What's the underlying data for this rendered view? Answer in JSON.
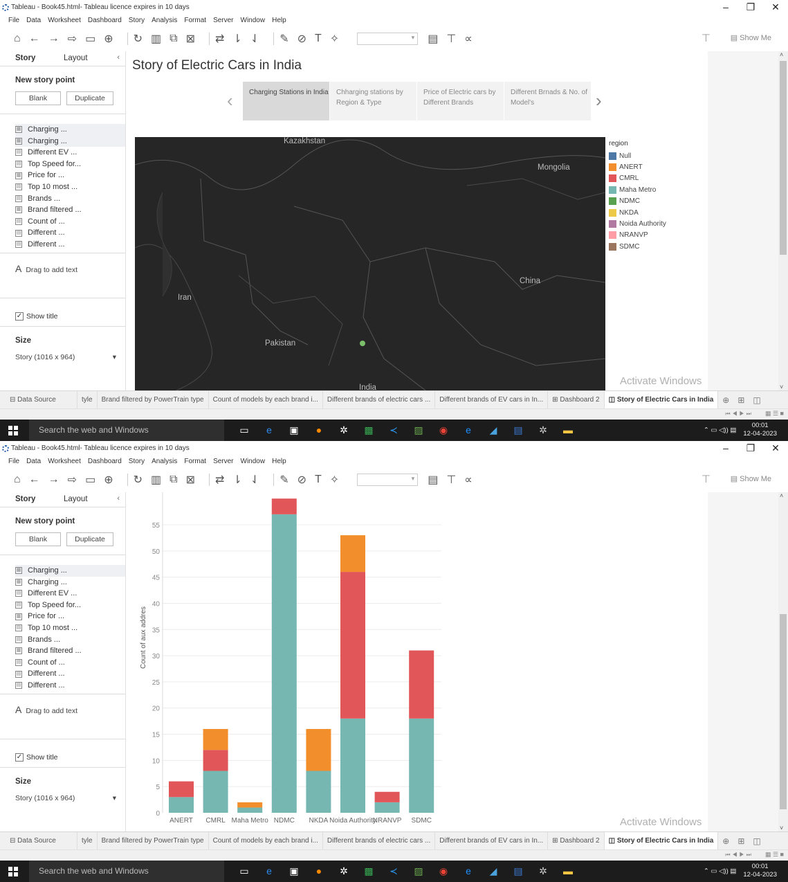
{
  "window": {
    "title": "Tableau - Book45.html- Tableau licence expires in 10 days",
    "min": "–",
    "restore": "❐",
    "close": "✕"
  },
  "menu": [
    "File",
    "Data",
    "Worksheet",
    "Dashboard",
    "Story",
    "Analysis",
    "Format",
    "Server",
    "Window",
    "Help"
  ],
  "toolbar": {
    "show_me": "Show Me"
  },
  "sidebar": {
    "tabs": [
      "Story",
      "Layout"
    ],
    "collapse": "‹",
    "new_story_point": "New story point",
    "blank": "Blank",
    "duplicate": "Duplicate",
    "sheets": [
      {
        "label": "Charging ...",
        "icon": "dashboard"
      },
      {
        "label": "Charging ...",
        "icon": "dashboard"
      },
      {
        "label": "Different EV ...",
        "icon": "worksheet"
      },
      {
        "label": "Top Speed for...",
        "icon": "worksheet"
      },
      {
        "label": "Price for ...",
        "icon": "dashboard"
      },
      {
        "label": "Top 10 most ...",
        "icon": "worksheet"
      },
      {
        "label": "Brands ...",
        "icon": "worksheet"
      },
      {
        "label": "Brand filtered ...",
        "icon": "dashboard"
      },
      {
        "label": "Count of ...",
        "icon": "worksheet"
      },
      {
        "label": "Different ...",
        "icon": "worksheet"
      },
      {
        "label": "Different ...",
        "icon": "worksheet"
      }
    ],
    "drag_text": "Drag to add text",
    "drag_icon": "A",
    "show_title": "Show title",
    "size_title": "Size",
    "size_value": "Story (1016 x 964)"
  },
  "story": {
    "title": "Story of Electric Cars in India",
    "points": [
      "Charging Stations in India",
      "Chharging stations by Region & Type",
      "Price of Electric cars by Different  Brands",
      "Different Brnads & No. of Model's"
    ],
    "active_point": 0
  },
  "map": {
    "labels": [
      {
        "text": "Kazakhstan"
      },
      {
        "text": "Mongolia"
      },
      {
        "text": "China"
      },
      {
        "text": "Iran"
      },
      {
        "text": "Pakistan"
      },
      {
        "text": "India"
      }
    ]
  },
  "legend": {
    "title": "region",
    "items": [
      {
        "label": "Null",
        "color": "#4e79a7"
      },
      {
        "label": "ANERT",
        "color": "#f28e2b"
      },
      {
        "label": "CMRL",
        "color": "#e15759"
      },
      {
        "label": "Maha Metro",
        "color": "#76b7b2"
      },
      {
        "label": "NDMC",
        "color": "#59a14f"
      },
      {
        "label": "NKDA",
        "color": "#edc948"
      },
      {
        "label": "Noida Authority",
        "color": "#b07aa1"
      },
      {
        "label": "NRANVP",
        "color": "#ff9da7"
      },
      {
        "label": "SDMC",
        "color": "#9c755f"
      }
    ]
  },
  "watermark": {
    "line1": "Activate Windows",
    "line2": "Go to Settings to activate Windows."
  },
  "sheet_tabs": [
    "Data Source",
    "tyle",
    "Brand filtered by PowerTrain type",
    "Count of models by each brand i...",
    "Different brands of electric cars ...",
    "Different brands of EV cars in In...",
    "Dashboard 2",
    "Story of Electric Cars in India"
  ],
  "taskbar": {
    "search": "Search the web and Windows",
    "time": "00:01",
    "date": "12-04-2023"
  },
  "chart_data": {
    "type": "bar",
    "stacked": true,
    "ylabel": "Count of aux addres",
    "categories": [
      "ANERT",
      "CMRL",
      "Maha Metro",
      "NDMC",
      "NKDA",
      "Noida Authority",
      "NRANVP",
      "SDMC"
    ],
    "series": [
      {
        "color": "#76b7b2",
        "values": [
          3,
          8,
          1,
          57,
          8,
          18,
          2,
          18
        ]
      },
      {
        "color": "#e15759",
        "values": [
          3,
          4,
          0,
          3,
          0,
          28,
          2,
          13
        ]
      },
      {
        "color": "#f28e2b",
        "values": [
          0,
          4,
          1,
          0,
          8,
          7,
          0,
          0
        ]
      }
    ],
    "yticks": [
      0,
      5,
      10,
      15,
      20,
      25,
      30,
      35,
      40,
      45,
      50,
      55
    ],
    "ylim": [
      0,
      60
    ],
    "grid": true
  }
}
